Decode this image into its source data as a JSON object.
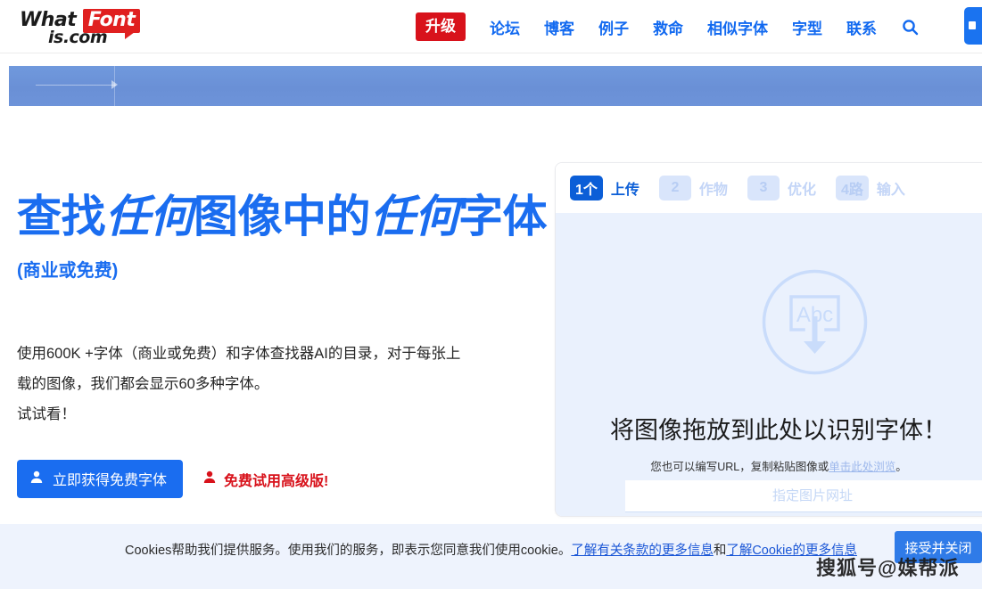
{
  "header": {
    "logo": {
      "what": "What",
      "font": "Font",
      "domain": "is.com"
    },
    "nav": {
      "upgrade": "升级",
      "items": [
        {
          "label": "论坛"
        },
        {
          "label": "博客"
        },
        {
          "label": "例子"
        },
        {
          "label": "救命"
        },
        {
          "label": "相似字体"
        },
        {
          "label": "字型"
        },
        {
          "label": "联系"
        }
      ],
      "search_icon": "search-icon"
    }
  },
  "hero": {
    "title_part1": "查找",
    "title_em1": "任何",
    "title_part2": "图像中的",
    "title_em2": "任何",
    "title_part3": "字体",
    "subtitle": "(商业或免费)",
    "body_line1": "使用600K +字体（商业或免费）和字体查找器AI的目录，对于每张上",
    "body_line2": "载的图像，我们都会显示60多种字体。",
    "body_line3": "试试看！",
    "cta_primary": "立即获得免费字体",
    "cta_secondary": "免费试用高级版!"
  },
  "panel": {
    "steps": [
      {
        "num": "1个",
        "label": "上传",
        "state": "active"
      },
      {
        "num": "2",
        "label": "作物",
        "state": "inactive"
      },
      {
        "num": "3",
        "label": "优化",
        "state": "inactive"
      },
      {
        "num": "4路",
        "label": "输入",
        "state": "inactive"
      }
    ],
    "dropzone": {
      "icon_text": "Abc",
      "title": "将图像拖放到此处以识别字体！",
      "sub_prefix": "您也可以编写URL，复制粘贴图像或",
      "sub_link": "单击此处浏览",
      "sub_suffix": "。",
      "url_placeholder": "指定图片网址",
      "url_value": ""
    }
  },
  "cookie": {
    "text_prefix": "Cookies帮助我们提供服务。使用我们的服务，即表示您同意我们使用cookie。",
    "link1": "了解有关条款的更多信息",
    "between": "和",
    "link2": "了解Cookie的更多信息",
    "accept_button": "接受并关闭"
  },
  "watermark": {
    "text": "搜狐号@媒帮派"
  },
  "colors": {
    "brand_blue": "#1a6df0",
    "nav_blue": "#1169f0",
    "upgrade_red": "#d8121b",
    "logo_red": "#e02020",
    "dropzone_bg": "#eaf1fd",
    "cookie_bg": "#eef3fd",
    "ad_blue": "#6d93d9"
  }
}
